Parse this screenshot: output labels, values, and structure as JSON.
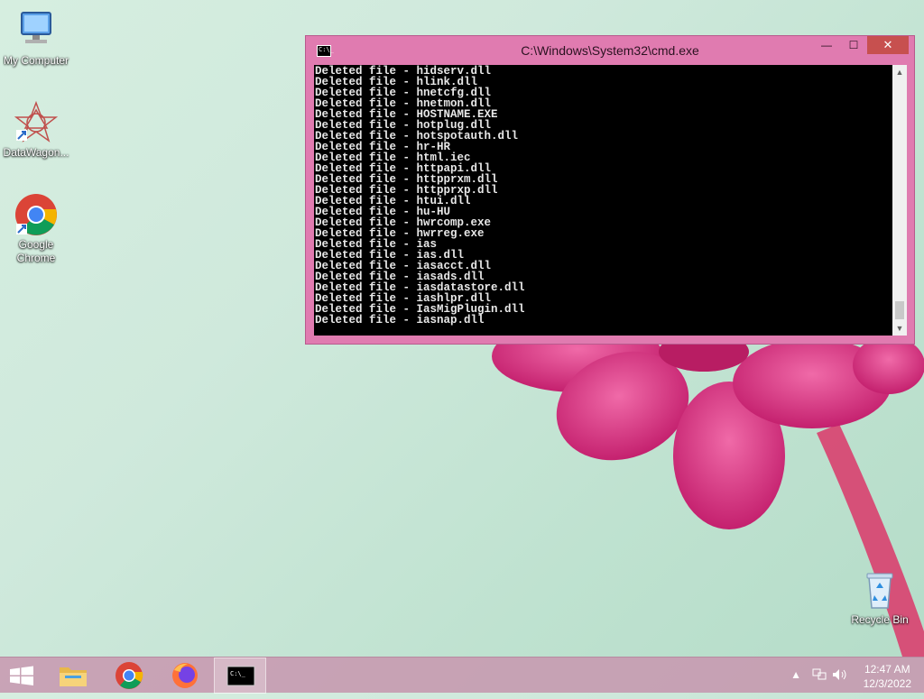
{
  "desktop": {
    "icons": [
      {
        "label": "My Computer"
      },
      {
        "label": "DataWagon..."
      },
      {
        "label": "Google Chrome"
      },
      {
        "label": "Recycle Bin"
      }
    ]
  },
  "window": {
    "title": "C:\\Windows\\System32\\cmd.exe",
    "icon_text": "C:\\_",
    "minimize_glyph": "—",
    "maximize_glyph": "☐",
    "close_glyph": "✕",
    "console_lines": [
      "Deleted file - hidserv.dll",
      "Deleted file - hlink.dll",
      "Deleted file - hnetcfg.dll",
      "Deleted file - hnetmon.dll",
      "Deleted file - HOSTNAME.EXE",
      "Deleted file - hotplug.dll",
      "Deleted file - hotspotauth.dll",
      "Deleted file - hr-HR",
      "Deleted file - html.iec",
      "Deleted file - httpapi.dll",
      "Deleted file - httpprxm.dll",
      "Deleted file - httpprxp.dll",
      "Deleted file - htui.dll",
      "Deleted file - hu-HU",
      "Deleted file - hwrcomp.exe",
      "Deleted file - hwrreg.exe",
      "Deleted file - ias",
      "Deleted file - ias.dll",
      "Deleted file - iasacct.dll",
      "Deleted file - iasads.dll",
      "Deleted file - iasdatastore.dll",
      "Deleted file - iashlpr.dll",
      "Deleted file - IasMigPlugin.dll",
      "Deleted file - iasnap.dll"
    ]
  },
  "taskbar": {
    "time": "12:47 AM",
    "date": "12/3/2022",
    "items": [
      "start",
      "file-explorer",
      "chrome",
      "firefox",
      "cmd"
    ]
  },
  "colors": {
    "window_frame": "#e07bb0",
    "close_button": "#c7504f",
    "taskbar": "#c896af"
  }
}
